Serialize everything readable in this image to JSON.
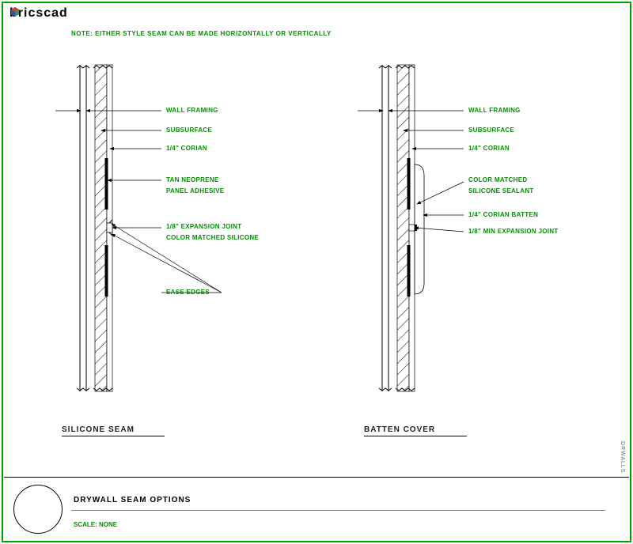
{
  "app": {
    "name": "bricscad"
  },
  "note": "NOTE: EITHER STYLE SEAM CAN BE MADE HORIZONTALLY OR VERTICALLY",
  "left_detail": {
    "title": "SILICONE SEAM",
    "labels": {
      "wall_framing": "WALL FRAMING",
      "subsurface": "SUBSURFACE",
      "corian": "1/4\" CORIAN",
      "adhesive_l1": "TAN NEOPRENE",
      "adhesive_l2": "PANEL ADHESIVE",
      "joint_l1": "1/8\" EXPANSION JOINT",
      "joint_l2": "COLOR MATCHED SILICONE",
      "ease": "EASE EDGES"
    }
  },
  "right_detail": {
    "title": "BATTEN COVER",
    "labels": {
      "wall_framing": "WALL FRAMING",
      "subsurface": "SUBSURFACE",
      "corian": "1/4\" CORIAN",
      "sealant_l1": "COLOR MATCHED",
      "sealant_l2": "SILICONE SEALANT",
      "batten": "1/4\" CORIAN BATTEN",
      "exp_joint": "1/8\" MIN EXPANSION JOINT"
    }
  },
  "title_block": {
    "main": "DRYWALL SEAM OPTIONS",
    "scale": "SCALE: NONE"
  },
  "side_text": "DRWALLS"
}
